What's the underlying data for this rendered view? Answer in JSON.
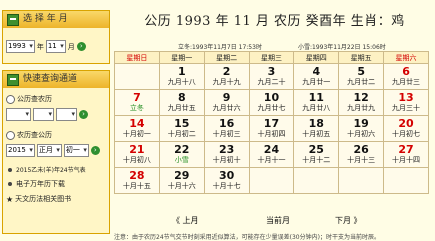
{
  "left": {
    "box1": {
      "title": "选 择 年 月",
      "year_value": "1993",
      "year_suffix": "年",
      "month_value": "11",
      "month_suffix": "月"
    },
    "box2": {
      "title": "快速查询通道",
      "item1": "公历查农历",
      "item2": "农历查公历",
      "year2_value": "2015",
      "month2_value": "正月",
      "day2_value": "初一",
      "link1": "2015乙未(羊)年24节气表",
      "link2": "电子万年历下载",
      "link3": "天文历法相关图书"
    }
  },
  "main": {
    "title": "公历 1993 年 11 月   农历   癸酉年   生肖：鸡",
    "info_left": "立冬:1993年11月7日 17:53时",
    "info_right": "小雪:1993年11月22日 15:06时",
    "weekdays": [
      "星期日",
      "星期一",
      "星期二",
      "星期三",
      "星期四",
      "星期五",
      "星期六"
    ],
    "weeks": [
      [
        null,
        {
          "d": "1",
          "l": "九月十八"
        },
        {
          "d": "2",
          "l": "九月十九"
        },
        {
          "d": "3",
          "l": "九月二十"
        },
        {
          "d": "4",
          "l": "九月廿一"
        },
        {
          "d": "5",
          "l": "九月廿二"
        },
        {
          "d": "6",
          "l": "九月廿三"
        }
      ],
      [
        {
          "d": "7",
          "l": "立冬"
        },
        {
          "d": "8",
          "l": "九月廿五"
        },
        {
          "d": "9",
          "l": "九月廿六"
        },
        {
          "d": "10",
          "l": "九月廿七"
        },
        {
          "d": "11",
          "l": "九月廿八"
        },
        {
          "d": "12",
          "l": "九月廿九"
        },
        {
          "d": "13",
          "l": "九月三十"
        }
      ],
      [
        {
          "d": "14",
          "l": "十月初一"
        },
        {
          "d": "15",
          "l": "十月初二"
        },
        {
          "d": "16",
          "l": "十月初三"
        },
        {
          "d": "17",
          "l": "十月初四"
        },
        {
          "d": "18",
          "l": "十月初五"
        },
        {
          "d": "19",
          "l": "十月初六"
        },
        {
          "d": "20",
          "l": "十月初七"
        }
      ],
      [
        {
          "d": "21",
          "l": "十月初八"
        },
        {
          "d": "22",
          "l": "小雪"
        },
        {
          "d": "23",
          "l": "十月初十"
        },
        {
          "d": "24",
          "l": "十月十一"
        },
        {
          "d": "25",
          "l": "十月十二"
        },
        {
          "d": "26",
          "l": "十月十三"
        },
        {
          "d": "27",
          "l": "十月十四"
        }
      ],
      [
        {
          "d": "28",
          "l": "十月十五"
        },
        {
          "d": "29",
          "l": "十月十六"
        },
        {
          "d": "30",
          "l": "十月十七"
        },
        null,
        null,
        null,
        null
      ]
    ],
    "nav_prev": "《 上月",
    "nav_current": "当前月",
    "nav_next": "下月 》",
    "footnote": "注意：由于农历24节气交节时刻采用近似算法，可能存在少量误差(30分钟内)；时干支为当前时辰。"
  },
  "colors": {
    "weekend": "#D40000",
    "solar_term": "#1B8A1B",
    "today_bg": "#FFE36B",
    "header_bg": "#FDF1C3"
  }
}
